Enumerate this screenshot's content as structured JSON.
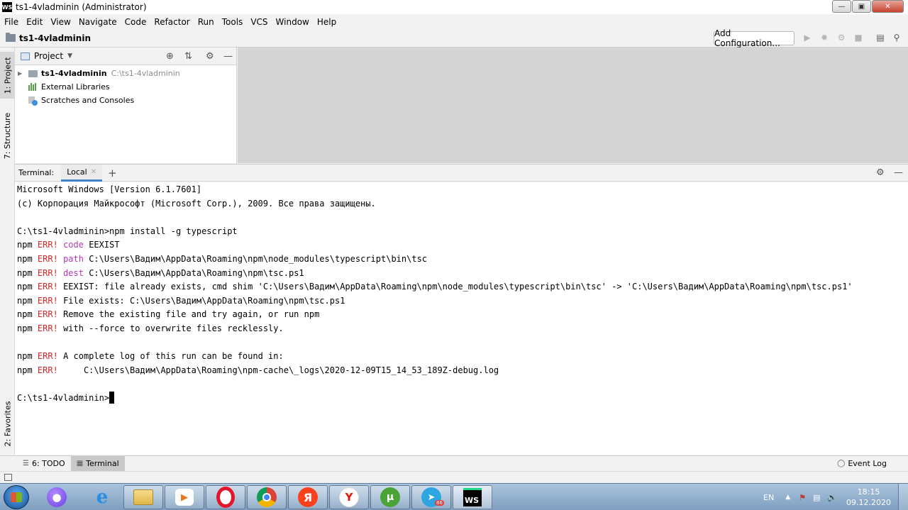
{
  "window": {
    "app_icon": "WS",
    "title": "ts1-4vladminin (Administrator)",
    "controls": [
      "minimize",
      "maximize",
      "close"
    ]
  },
  "menu": [
    "File",
    "Edit",
    "View",
    "Navigate",
    "Code",
    "Refactor",
    "Run",
    "Tools",
    "VCS",
    "Window",
    "Help"
  ],
  "navbar": {
    "breadcrumb": "ts1-4vladminin",
    "add_config": "Add Configuration..."
  },
  "left_stripe": {
    "project_tab": "1: Project",
    "structure_tab": "7: Structure",
    "favorites_tab": "2: Favorites"
  },
  "project_panel": {
    "title": "Project",
    "tree": [
      {
        "label": "ts1-4vladminin",
        "path": "C:\\ts1-4vladminin"
      },
      {
        "label": "External Libraries"
      },
      {
        "label": "Scratches and Consoles"
      }
    ]
  },
  "terminal": {
    "title": "Terminal:",
    "tab": "Local",
    "add": "+",
    "lines": {
      "l1": "Microsoft Windows [Version 6.1.7601]",
      "l2": "(c) Корпорация Майкрософт (Microsoft Corp.), 2009. Все права защищены.",
      "l4": "C:\\ts1-4vladminin>npm install -g typescript",
      "npm": "npm",
      "err": "ERR!",
      "code_kw": "code",
      "code_val": "EEXIST",
      "path_kw": "path",
      "path_val": "C:\\Users\\Вадим\\AppData\\Roaming\\npm\\node_modules\\typescript\\bin\\tsc",
      "dest_kw": "dest",
      "dest_val": "C:\\Users\\Вадим\\AppData\\Roaming\\npm\\tsc.ps1",
      "eexist": "EEXIST: file already exists, cmd shim 'C:\\Users\\Вадим\\AppData\\Roaming\\npm\\node_modules\\typescript\\bin\\tsc' -> 'C:\\Users\\Вадим\\AppData\\Roaming\\npm\\tsc.ps1'",
      "file_exists": "File exists: C:\\Users\\Вадим\\AppData\\Roaming\\npm\\tsc.ps1",
      "remove": "Remove the existing file and try again, or run npm",
      "force": "with --force to overwrite files recklessly.",
      "log1": "A complete log of this run can be found in:",
      "log2": "    C:\\Users\\Вадим\\AppData\\Roaming\\npm-cache\\_logs\\2020-12-09T15_14_53_189Z-debug.log",
      "prompt": "C:\\ts1-4vladminin>"
    }
  },
  "bottom_bar": {
    "todo": "6: TODO",
    "terminal": "Terminal",
    "event_log": "Event Log"
  },
  "taskbar": {
    "apps": [
      "start-orb",
      "yandex-alice",
      "internet-explorer",
      "file-explorer",
      "media-player",
      "opera",
      "chrome",
      "yandex-browser",
      "yandex",
      "utorrent",
      "telegram",
      "webstorm"
    ],
    "telegram_badge": "86",
    "lang": "EN",
    "time": "18:15",
    "date": "09.12.2020"
  }
}
